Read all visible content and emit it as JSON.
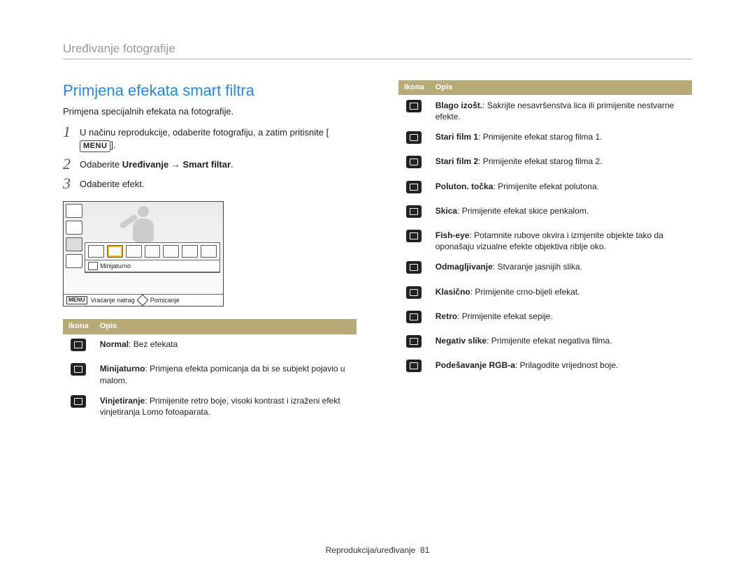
{
  "header": {
    "breadcrumb": "Uređivanje fotografije"
  },
  "left": {
    "heading": "Primjena efekata smart filtra",
    "intro": "Primjena specijalnih efekata na fotografije.",
    "steps": [
      {
        "num": "1",
        "pre": "U načinu reprodukcije, odaberite fotografiju, a zatim pritisnite [",
        "keylabel": "MENU",
        "post": "]."
      },
      {
        "num": "2",
        "pre": "Odaberite ",
        "bold": "Uređivanje → Smart filtar",
        "post": "."
      },
      {
        "num": "3",
        "pre": "Odaberite efekt.",
        "bold": "",
        "post": ""
      }
    ],
    "screenshot": {
      "selected_label": "Minijaturno",
      "footer_menu_key": "MENU",
      "footer_back": "Vraćanje natrag",
      "footer_move": "Pomicanje"
    },
    "table_head": {
      "icon": "Ikona",
      "desc": "Opis"
    },
    "table_rows": [
      {
        "bold": "Normal",
        "text": ": Bez efekata"
      },
      {
        "bold": "Minijaturno",
        "text": ": Primjena efekta pomicanja da bi se subjekt pojavio u malom."
      },
      {
        "bold": "Vinjetiranje",
        "text": ": Primijenite retro boje, visoki kontrast i izraženi efekt vinjetiranja Lomo fotoaparata."
      }
    ]
  },
  "right": {
    "table_head": {
      "icon": "Ikona",
      "desc": "Opis"
    },
    "table_rows": [
      {
        "bold": "Blago izošt.",
        "text": ": Sakrijte nesavršenstva lica ili primijenite nestvarne efekte."
      },
      {
        "bold": "Stari film 1",
        "text": ": Primijenite efekat starog filma 1."
      },
      {
        "bold": "Stari film 2",
        "text": ": Primijenite efekat starog filma 2."
      },
      {
        "bold": "Poluton. točka",
        "text": ": Primijenite efekat polutona."
      },
      {
        "bold": "Skica",
        "text": ": Primijenite efekat skice penkalom."
      },
      {
        "bold": "Fish-eye",
        "text": ": Potamnite rubove okvira i izmjenite objekte tako da oponašaju vizualne efekte objektiva riblje oko."
      },
      {
        "bold": "Odmagljivanje",
        "text": ": Stvaranje jasnijih slika."
      },
      {
        "bold": "Klasično",
        "text": ": Primijenite crno-bijeli efekat."
      },
      {
        "bold": "Retro",
        "text": ": Primijenite efekat sepije."
      },
      {
        "bold": "Negativ slike",
        "text": ": Primijenite efekat negativa filma."
      },
      {
        "bold": "Podešavanje RGB-a",
        "text": ": Prilagodite vrijednost boje."
      }
    ]
  },
  "footer": {
    "text": "Reprodukcija/uređivanje",
    "page": "81"
  }
}
